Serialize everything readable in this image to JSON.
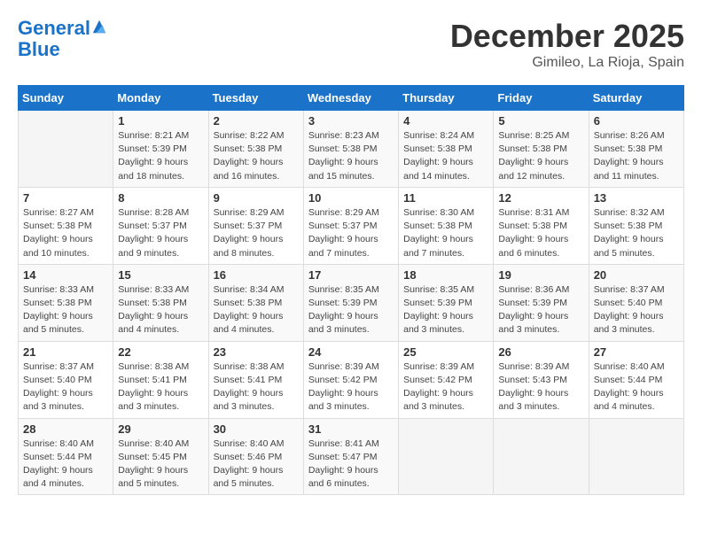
{
  "header": {
    "logo_line1": "General",
    "logo_line2": "Blue",
    "month": "December 2025",
    "location": "Gimileo, La Rioja, Spain"
  },
  "weekdays": [
    "Sunday",
    "Monday",
    "Tuesday",
    "Wednesday",
    "Thursday",
    "Friday",
    "Saturday"
  ],
  "weeks": [
    [
      {
        "day": "",
        "empty": true
      },
      {
        "day": "1",
        "sunrise": "8:21 AM",
        "sunset": "5:39 PM",
        "daylight": "9 hours and 18 minutes."
      },
      {
        "day": "2",
        "sunrise": "8:22 AM",
        "sunset": "5:38 PM",
        "daylight": "9 hours and 16 minutes."
      },
      {
        "day": "3",
        "sunrise": "8:23 AM",
        "sunset": "5:38 PM",
        "daylight": "9 hours and 15 minutes."
      },
      {
        "day": "4",
        "sunrise": "8:24 AM",
        "sunset": "5:38 PM",
        "daylight": "9 hours and 14 minutes."
      },
      {
        "day": "5",
        "sunrise": "8:25 AM",
        "sunset": "5:38 PM",
        "daylight": "9 hours and 12 minutes."
      },
      {
        "day": "6",
        "sunrise": "8:26 AM",
        "sunset": "5:38 PM",
        "daylight": "9 hours and 11 minutes."
      }
    ],
    [
      {
        "day": "7",
        "sunrise": "8:27 AM",
        "sunset": "5:38 PM",
        "daylight": "9 hours and 10 minutes."
      },
      {
        "day": "8",
        "sunrise": "8:28 AM",
        "sunset": "5:37 PM",
        "daylight": "9 hours and 9 minutes."
      },
      {
        "day": "9",
        "sunrise": "8:29 AM",
        "sunset": "5:37 PM",
        "daylight": "9 hours and 8 minutes."
      },
      {
        "day": "10",
        "sunrise": "8:29 AM",
        "sunset": "5:37 PM",
        "daylight": "9 hours and 7 minutes."
      },
      {
        "day": "11",
        "sunrise": "8:30 AM",
        "sunset": "5:38 PM",
        "daylight": "9 hours and 7 minutes."
      },
      {
        "day": "12",
        "sunrise": "8:31 AM",
        "sunset": "5:38 PM",
        "daylight": "9 hours and 6 minutes."
      },
      {
        "day": "13",
        "sunrise": "8:32 AM",
        "sunset": "5:38 PM",
        "daylight": "9 hours and 5 minutes."
      }
    ],
    [
      {
        "day": "14",
        "sunrise": "8:33 AM",
        "sunset": "5:38 PM",
        "daylight": "9 hours and 5 minutes."
      },
      {
        "day": "15",
        "sunrise": "8:33 AM",
        "sunset": "5:38 PM",
        "daylight": "9 hours and 4 minutes."
      },
      {
        "day": "16",
        "sunrise": "8:34 AM",
        "sunset": "5:38 PM",
        "daylight": "9 hours and 4 minutes."
      },
      {
        "day": "17",
        "sunrise": "8:35 AM",
        "sunset": "5:39 PM",
        "daylight": "9 hours and 3 minutes."
      },
      {
        "day": "18",
        "sunrise": "8:35 AM",
        "sunset": "5:39 PM",
        "daylight": "9 hours and 3 minutes."
      },
      {
        "day": "19",
        "sunrise": "8:36 AM",
        "sunset": "5:39 PM",
        "daylight": "9 hours and 3 minutes."
      },
      {
        "day": "20",
        "sunrise": "8:37 AM",
        "sunset": "5:40 PM",
        "daylight": "9 hours and 3 minutes."
      }
    ],
    [
      {
        "day": "21",
        "sunrise": "8:37 AM",
        "sunset": "5:40 PM",
        "daylight": "9 hours and 3 minutes."
      },
      {
        "day": "22",
        "sunrise": "8:38 AM",
        "sunset": "5:41 PM",
        "daylight": "9 hours and 3 minutes."
      },
      {
        "day": "23",
        "sunrise": "8:38 AM",
        "sunset": "5:41 PM",
        "daylight": "9 hours and 3 minutes."
      },
      {
        "day": "24",
        "sunrise": "8:39 AM",
        "sunset": "5:42 PM",
        "daylight": "9 hours and 3 minutes."
      },
      {
        "day": "25",
        "sunrise": "8:39 AM",
        "sunset": "5:42 PM",
        "daylight": "9 hours and 3 minutes."
      },
      {
        "day": "26",
        "sunrise": "8:39 AM",
        "sunset": "5:43 PM",
        "daylight": "9 hours and 3 minutes."
      },
      {
        "day": "27",
        "sunrise": "8:40 AM",
        "sunset": "5:44 PM",
        "daylight": "9 hours and 4 minutes."
      }
    ],
    [
      {
        "day": "28",
        "sunrise": "8:40 AM",
        "sunset": "5:44 PM",
        "daylight": "9 hours and 4 minutes."
      },
      {
        "day": "29",
        "sunrise": "8:40 AM",
        "sunset": "5:45 PM",
        "daylight": "9 hours and 5 minutes."
      },
      {
        "day": "30",
        "sunrise": "8:40 AM",
        "sunset": "5:46 PM",
        "daylight": "9 hours and 5 minutes."
      },
      {
        "day": "31",
        "sunrise": "8:41 AM",
        "sunset": "5:47 PM",
        "daylight": "9 hours and 6 minutes."
      },
      {
        "day": "",
        "empty": true
      },
      {
        "day": "",
        "empty": true
      },
      {
        "day": "",
        "empty": true
      }
    ]
  ]
}
